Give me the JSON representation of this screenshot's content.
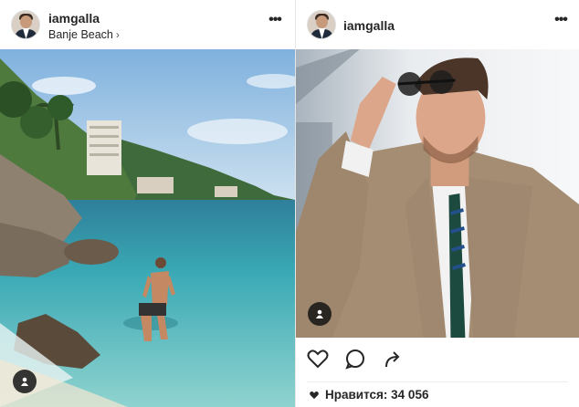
{
  "posts": [
    {
      "username": "iamgalla",
      "location": "Banje Beach",
      "icons": {
        "more": "more-options-icon",
        "tag": "user-tag-icon",
        "location_chevron": "chevron-right-icon"
      }
    },
    {
      "username": "iamgalla",
      "icons": {
        "more": "more-options-icon",
        "tag": "user-tag-icon"
      },
      "actions": {
        "like": "heart-icon",
        "comment": "comment-icon",
        "share": "share-icon"
      },
      "likes_label": "Нравится: 34 056"
    }
  ],
  "glyphs": {
    "more": "•••",
    "chevron": "›"
  },
  "colors": {
    "text": "#262626",
    "divider": "#efefef",
    "badge": "#141414"
  }
}
